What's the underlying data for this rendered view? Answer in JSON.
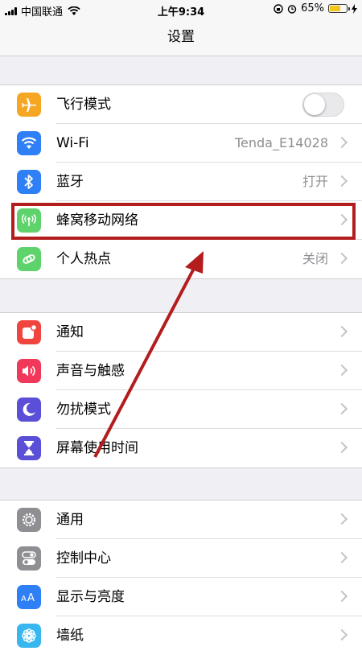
{
  "status": {
    "carrier": "中国联通",
    "time": "上午9:34",
    "battery": "65%",
    "battery_level": 0.65
  },
  "nav": {
    "title": "设置"
  },
  "groups": [
    {
      "items": [
        {
          "label": "飞行模式",
          "icon": "airplane-icon",
          "color": "#f5a623",
          "toggle": false
        },
        {
          "label": "Wi-Fi",
          "value": "Tenda_E14028",
          "icon": "wifi-icon",
          "color": "#2f7ff6"
        },
        {
          "label": "蓝牙",
          "value": "打开",
          "icon": "bluetooth-icon",
          "color": "#2f7ff6"
        },
        {
          "label": "蜂窝移动网络",
          "icon": "cellular-icon",
          "color": "#5fd36b"
        },
        {
          "label": "个人热点",
          "value": "关闭",
          "icon": "hotspot-icon",
          "color": "#5fd36b"
        }
      ]
    },
    {
      "items": [
        {
          "label": "通知",
          "icon": "notifications-icon",
          "color": "#f0453f"
        },
        {
          "label": "声音与触感",
          "icon": "sound-icon",
          "color": "#f0395a"
        },
        {
          "label": "勿扰模式",
          "icon": "moon-icon",
          "color": "#5b4fd8"
        },
        {
          "label": "屏幕使用时间",
          "icon": "hourglass-icon",
          "color": "#5b4fd8"
        }
      ]
    },
    {
      "items": [
        {
          "label": "通用",
          "icon": "gear-icon",
          "color": "#8e8e93"
        },
        {
          "label": "控制中心",
          "icon": "switches-icon",
          "color": "#8e8e93"
        },
        {
          "label": "显示与亮度",
          "icon": "display-icon",
          "color": "#2f7ff6"
        },
        {
          "label": "墙纸",
          "icon": "flower-icon",
          "color": "#37b6f0"
        }
      ]
    }
  ],
  "annotation_color": "#b31d1d"
}
